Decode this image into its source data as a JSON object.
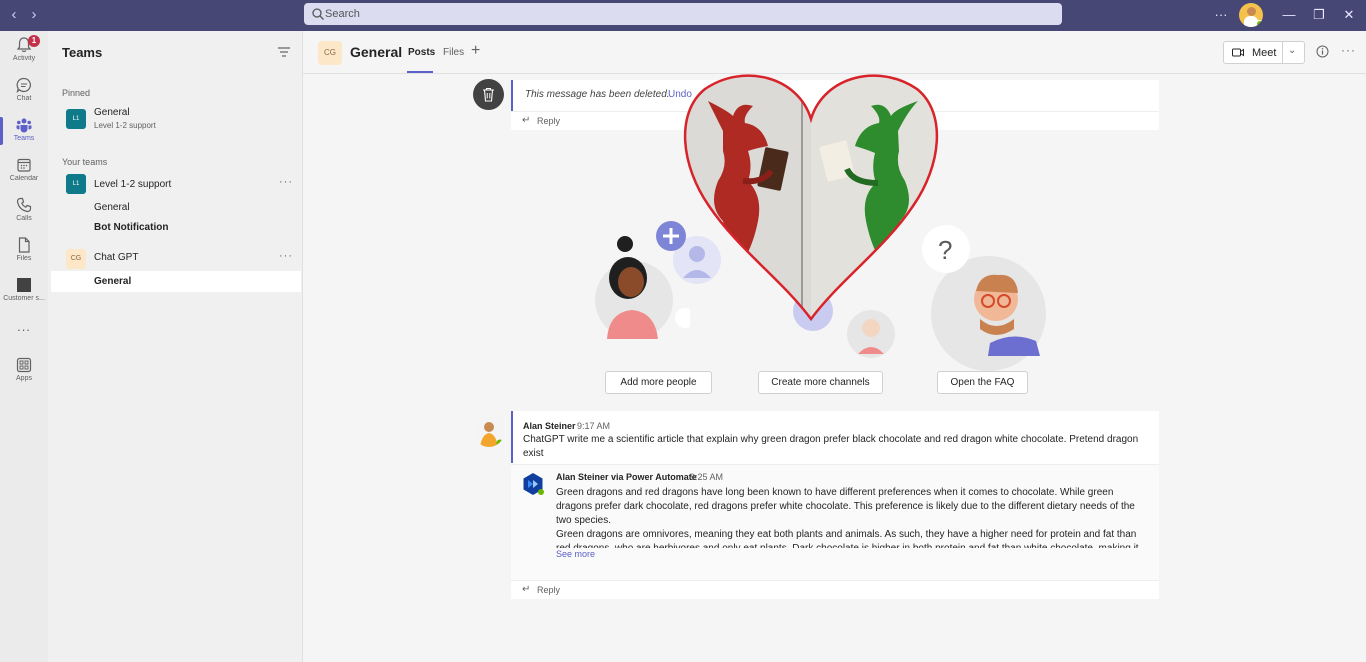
{
  "titlebar": {
    "search_placeholder": "Search",
    "more_label": "···",
    "minimize": "—",
    "restore": "❐",
    "close": "✕"
  },
  "rail": {
    "items": [
      {
        "label": "Activity",
        "icon": "bell-icon",
        "badge": "1"
      },
      {
        "label": "Chat",
        "icon": "chat-icon"
      },
      {
        "label": "Teams",
        "icon": "teams-icon"
      },
      {
        "label": "Calendar",
        "icon": "calendar-icon"
      },
      {
        "label": "Calls",
        "icon": "phone-icon"
      },
      {
        "label": "Files",
        "icon": "file-icon"
      },
      {
        "label": "Customer s...",
        "icon": "app-icon"
      },
      {
        "label": "...",
        "icon": "more-icon"
      },
      {
        "label": "Apps",
        "icon": "apps-icon"
      }
    ]
  },
  "sidebar": {
    "title": "Teams",
    "pinned_label": "Pinned",
    "pinned": {
      "tile": "L1",
      "name": "General",
      "sub": "Level 1-2 support"
    },
    "your_teams_label": "Your teams",
    "teams": [
      {
        "tile": "L1",
        "name": "Level 1-2 support",
        "channels": [
          "General",
          "Bot Notification"
        ]
      },
      {
        "tile": "CG",
        "name": "Chat GPT",
        "channels": [
          "General"
        ]
      }
    ]
  },
  "channel": {
    "tile": "CG",
    "name": "General",
    "tabs": [
      "Posts",
      "Files"
    ],
    "add_tab": "+",
    "meet_label": "Meet"
  },
  "deleted_message": {
    "text": "This message has been deleted.",
    "undo": "Undo",
    "reply": "Reply"
  },
  "actions": [
    "Add more people",
    "Create more channels",
    "Open the FAQ"
  ],
  "post": {
    "author": "Alan Steiner",
    "time": "9:17 AM",
    "text": "ChatGPT write me a scientific article that explain why green dragon prefer black chocolate and red dragon white chocolate. Pretend dragon exist",
    "reply": {
      "author": "Alan Steiner via Power Automate",
      "time": "9:25 AM",
      "paragraph1": "Green dragons and red dragons have long been known to have different preferences when it comes to chocolate. While green dragons prefer dark chocolate, red dragons prefer white chocolate. This preference is likely due to the different dietary needs of the two species.",
      "paragraph2": "Green dragons are omnivores, meaning they eat both plants and animals. As such, they have a higher need for protein and fat than red dragons, who are herbivores and only eat plants. Dark chocolate is higher in both protein and fat than white chocolate, making it a",
      "see_more": "See more"
    },
    "reply_label": "Reply"
  },
  "colors": {
    "titlebar": "#464775",
    "accent": "#5b5fc7",
    "heart_outline": "#d8232a",
    "red_dragon": "#b02a24",
    "green_dragon": "#2e8b2e"
  }
}
